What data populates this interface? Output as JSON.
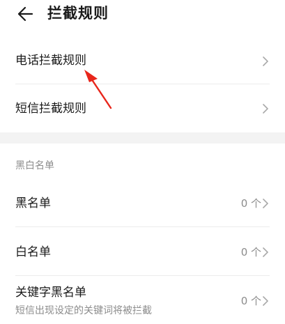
{
  "header": {
    "title": "拦截规则",
    "back_icon": "arrow-left-icon"
  },
  "rules": {
    "items": [
      {
        "label": "电话拦截规则",
        "icon": "chevron-right-icon"
      },
      {
        "label": "短信拦截规则",
        "icon": "chevron-right-icon"
      }
    ]
  },
  "lists": {
    "section_title": "黑白名单",
    "items": [
      {
        "label": "黑名单",
        "count": "0 个",
        "icon": "chevron-right-icon"
      },
      {
        "label": "白名单",
        "count": "0 个",
        "icon": "chevron-right-icon"
      },
      {
        "label": "关键字黑名单",
        "sublabel": "短信出现设定的关键词将被拦截",
        "count": "0 个",
        "icon": "chevron-right-icon"
      }
    ]
  },
  "colors": {
    "text_primary": "#1a1a1a",
    "text_secondary": "#8c8c8c",
    "annotation_arrow": "#e8261b"
  }
}
